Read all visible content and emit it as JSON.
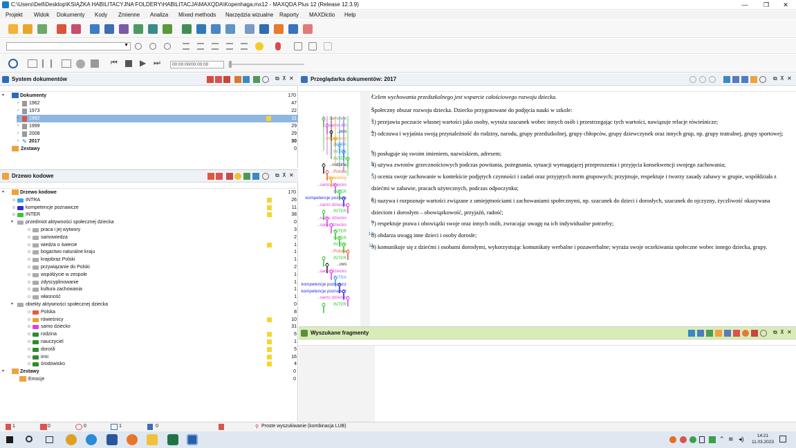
{
  "window": {
    "title": "C:\\Users\\Dell\\Desktop\\KSIĄŻKA HABILITACYJNA FOLDERY\\HABILITACJA\\MAXQDA\\Kopenhaga.mx12 - MAXQDA Plus 12  (Release 12.3.9)",
    "minimize": "—",
    "maximize": "❐",
    "close": "✕"
  },
  "menu": [
    "Projekt",
    "Widok",
    "Dokumenty",
    "Kody",
    "Zmienne",
    "Analiza",
    "Mixed methods",
    "Narzędzia wizualne",
    "Raporty",
    "MAXDictio",
    "Help"
  ],
  "media": {
    "time": "00:00:00/00:00:00"
  },
  "docsystem": {
    "title": "System dokumentów",
    "root": {
      "label": "Dokumenty",
      "count": "170"
    },
    "items": [
      {
        "label": "1962",
        "count": "47"
      },
      {
        "label": "1973",
        "count": "22"
      },
      {
        "label": "1992",
        "count": "11",
        "selected": true
      },
      {
        "label": "1999",
        "count": "29"
      },
      {
        "label": "2008",
        "count": "29"
      },
      {
        "label": "2017",
        "count": "30",
        "bold": true
      }
    ],
    "sets": {
      "label": "Zestawy",
      "count": "0"
    }
  },
  "codetree": {
    "title": "Drzewo kodowe",
    "root": {
      "label": "Drzewo kodowe",
      "count": "170"
    },
    "items": [
      {
        "label": "INTRA",
        "count": "26",
        "color": "#3aa0e8",
        "y": true,
        "lvl": 1
      },
      {
        "label": "kompetencje poznawcze",
        "count": "11",
        "color": "#2b2bd6",
        "y": true,
        "lvl": 1
      },
      {
        "label": "INTER",
        "count": "38",
        "color": "#32c832",
        "y": true,
        "lvl": 1
      },
      {
        "label": "przedmiot aktywności społecznej dziecka",
        "count": "0",
        "color": "#aaaaaa",
        "y": false,
        "lvl": 1,
        "open": true
      },
      {
        "label": "praca i jej wytwory",
        "count": "3",
        "color": "#aaaaaa",
        "y": false,
        "lvl": 2
      },
      {
        "label": "samowiedza",
        "count": "2",
        "color": "#aaaaaa",
        "y": false,
        "lvl": 2
      },
      {
        "label": "wiedza o świecie",
        "count": "1",
        "color": "#aaaaaa",
        "y": true,
        "lvl": 2
      },
      {
        "label": "bogactwo naturalne kraju",
        "count": "1",
        "color": "#aaaaaa",
        "y": false,
        "lvl": 2
      },
      {
        "label": "krajobraz Polski",
        "count": "1",
        "color": "#aaaaaa",
        "y": false,
        "lvl": 2
      },
      {
        "label": "przywiązanie do Polski",
        "count": "2",
        "color": "#aaaaaa",
        "y": false,
        "lvl": 2
      },
      {
        "label": "współżycie w zespole",
        "count": "1",
        "color": "#aaaaaa",
        "y": false,
        "lvl": 2
      },
      {
        "label": "zdyscyplinowanie",
        "count": "1",
        "color": "#aaaaaa",
        "y": false,
        "lvl": 2
      },
      {
        "label": "kultura zachowania",
        "count": "1",
        "color": "#aaaaaa",
        "y": false,
        "lvl": 2
      },
      {
        "label": "własność",
        "count": "1",
        "color": "#aaaaaa",
        "y": false,
        "lvl": 2
      },
      {
        "label": "obiekty aktywności społecznej dziecka",
        "count": "0",
        "color": "#aaaaaa",
        "y": false,
        "lvl": 1,
        "open": true
      },
      {
        "label": "Polska",
        "count": "8",
        "color": "#e85a3a",
        "y": false,
        "lvl": 2
      },
      {
        "label": "rówieśnicy",
        "count": "10",
        "color": "#f0a020",
        "y": true,
        "lvl": 2
      },
      {
        "label": "samo dziecko",
        "count": "31",
        "color": "#e040e0",
        "y": false,
        "lvl": 2
      },
      {
        "label": "rodzina",
        "count": "6",
        "color": "#2e8b2e",
        "y": true,
        "lvl": 2
      },
      {
        "label": "nauczyciel",
        "count": "1",
        "color": "#2e8b2e",
        "y": true,
        "lvl": 2
      },
      {
        "label": "dorośli",
        "count": "5",
        "color": "#2e8b2e",
        "y": true,
        "lvl": 2
      },
      {
        "label": "inni",
        "count": "16",
        "color": "#2e8b2e",
        "y": true,
        "lvl": 2
      },
      {
        "label": "środowisko",
        "count": "4",
        "color": "#2e8b2e",
        "y": true,
        "lvl": 2
      }
    ],
    "sets": {
      "label": "Zestawy",
      "count": "0"
    },
    "sets_items": [
      {
        "label": "Emocje",
        "count": "0"
      }
    ]
  },
  "browser": {
    "title": "Przeglądarka dokumentów: 2017",
    "lines": [
      {
        "n": "1",
        "text": "Celem wychowania przedszkolnego jest wsparcie całościowego rozwoju dziecka.",
        "italic": true
      },
      {
        "n": "2",
        "text": "Społeczny obszar rozwoju dziecka. Dziecko przygotowane do podjęcia nauki w szkole:"
      },
      {
        "n": "3",
        "text": "1) przejawia poczucie własnej wartości jako osoby, wyraża szacunek wobec innych osób i przestrzegając tych wartości, nawiązuje relacje rówieśnicze;"
      },
      {
        "n": "4",
        "text": "2) odczuwa i wyjaśnia swoją przynależność do rodziny, narodu, grupy przedszkolnej, grupy chłopców, grupy dziewczynek oraz innych grup, np. grupy teatralnej, grupy sportowej;"
      },
      {
        "n": "5",
        "text": "3) posługuje się swoim imieniem, nazwiskiem, adresem;"
      },
      {
        "n": "6",
        "text": "4) używa zwrotów grzecznościowych podczas powitania, pożegnania, sytuacji wymagającej przeproszenia i przyjęcia konsekwencji swojego zachowania;"
      },
      {
        "n": "7",
        "text": "5) ocenia swoje zachowanie w kontekście podjętych czynności i zadań oraz przyjętych norm grupowych; przyjmuje, respektuje i tworzy zasady zabawy w grupie, współdziała z dziećmi w zabawie, pracach użytecznych, podczas odpoczynku;"
      },
      {
        "n": "8",
        "text": "6) nazywa i rozpoznaje wartości związane z umiejętnościami i zachowaniami społecznymi, np. szacunek do dzieci i dorosłych, szacunek do ojczyzny, życzliwość okazywana dzieciom i dorosłym – obowiązkowość, przyjaźń, radość;"
      },
      {
        "n": "9",
        "text": "7) respektuje prawa i obowiązki swoje oraz innych osób, zwracając uwagę na ich indywidualne potrzeby;"
      },
      {
        "n": "10",
        "text": "8) obdarza uwagą inne dzieci i osoby dorosłe;"
      },
      {
        "n": "11",
        "text": "9) komunikuje się z dziećmi i osobami dorosłymi, wykorzystując komunikaty werbalne i pozawerbalne; wyraża swoje oczekiwania społeczne wobec innego dziecka, grupy."
      }
    ],
    "codes": [
      {
        "t": "..samowie",
        "c": "#888888"
      },
      {
        "t": "..samo dzi",
        "c": "#e040e0"
      },
      {
        "t": "..inni",
        "c": "#222222"
      },
      {
        "t": "..rówieśnicy",
        "c": "#f0a020"
      },
      {
        "t": "INTRA",
        "c": "#3aa0e8"
      },
      {
        "t": "INTRA",
        "c": "#3aa0e8"
      },
      {
        "t": "INTER",
        "c": "#32c832"
      },
      {
        "t": "..rodzina",
        "c": "#222222"
      },
      {
        "t": "..Polska",
        "c": "#e85a3a"
      },
      {
        "t": "..rówieśnicy",
        "c": "#f0a020"
      },
      {
        "t": "..samo dziecko",
        "c": "#e040e0"
      },
      {
        "t": "INTER",
        "c": "#32c832"
      },
      {
        "t": "kompetencje poznaw",
        "c": "#2b2bd6"
      },
      {
        "t": "..samo dziecko",
        "c": "#e040e0"
      },
      {
        "t": "INTER",
        "c": "#32c832"
      },
      {
        "t": "..samo dziecko",
        "c": "#e040e0"
      },
      {
        "t": "..samo dziecko",
        "c": "#e040e0"
      },
      {
        "t": "INTER",
        "c": "#32c832"
      },
      {
        "t": "INTER",
        "c": "#32c832"
      },
      {
        "t": "INTER",
        "c": "#32c832"
      },
      {
        "t": "..Polska",
        "c": "#e85a3a"
      },
      {
        "t": "INTER",
        "c": "#32c832"
      },
      {
        "t": "..inni",
        "c": "#222222"
      },
      {
        "t": "..samo dziecko",
        "c": "#e040e0"
      },
      {
        "t": "INTRA",
        "c": "#3aa0e8"
      },
      {
        "t": "kompetencje poznawcz",
        "c": "#2b2bd6"
      },
      {
        "t": "kompetencje poznawcz",
        "c": "#2b2bd6"
      },
      {
        "t": "..samo dziecko",
        "c": "#e040e0"
      },
      {
        "t": "INTER",
        "c": "#32c832"
      }
    ]
  },
  "retrieved": {
    "title": "Wyszukane fragmenty"
  },
  "status": {
    "docs": "1",
    "segs": "0",
    "codes": "0",
    "memos": "1",
    "weights": "0",
    "search": "Proste wyszukiwanie (kombinacja LUB)"
  },
  "taskbar": {
    "time": "14:21",
    "date": "11.03.2023"
  }
}
